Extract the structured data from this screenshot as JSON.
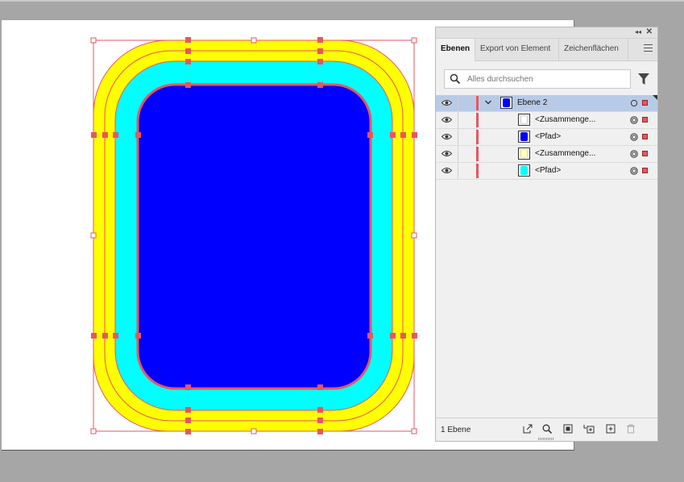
{
  "panel": {
    "tabs": [
      {
        "label": "Ebenen",
        "active": true
      },
      {
        "label": "Export von Element",
        "active": false
      },
      {
        "label": "Zeichenflächen",
        "active": false
      }
    ],
    "search": {
      "placeholder": "Alles durchsuchen"
    },
    "layers": [
      {
        "name": "Ebene 2",
        "level": 0,
        "expanded": true,
        "thumb_color": "#0000ff"
      },
      {
        "name": "<Zusammenge...",
        "level": 1,
        "thumb_color": "#ffffff"
      },
      {
        "name": "<Pfad>",
        "level": 1,
        "thumb_color": "#0000ff"
      },
      {
        "name": "<Zusammenge...",
        "level": 1,
        "thumb_color": "#ffffc0"
      },
      {
        "name": "<Pfad>",
        "level": 1,
        "thumb_color": "#00ffff"
      }
    ],
    "footer": {
      "count": "1 Ebene"
    },
    "layer_color": "#e8565f"
  },
  "artwork": {
    "colors": {
      "outer": "#ffff00",
      "middle": "#00ffff",
      "inner": "#0000ff",
      "selection": "#e8565f"
    }
  }
}
